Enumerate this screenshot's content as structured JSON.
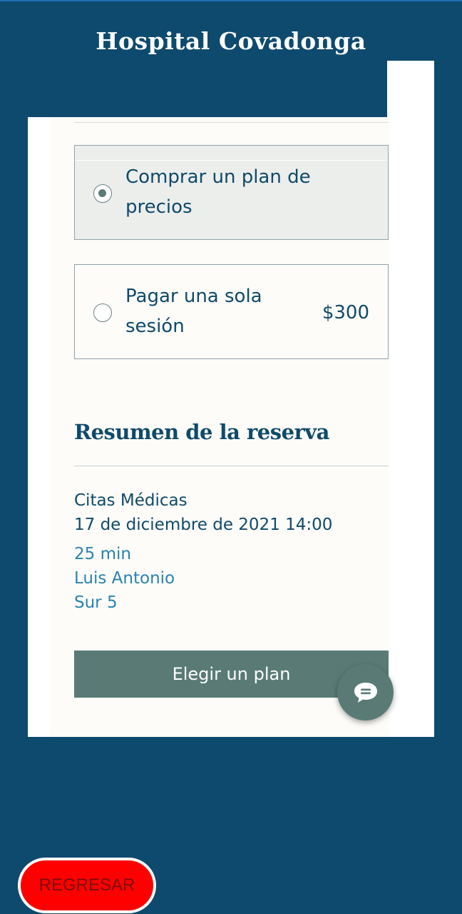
{
  "header": {
    "title": "Hospital Covadonga"
  },
  "options": [
    {
      "label": "Comprar un plan de precios",
      "price": "",
      "selected": true
    },
    {
      "label": "Pagar una sola sesión",
      "price": "$300",
      "selected": false
    }
  ],
  "summary": {
    "heading": "Resumen de la reserva",
    "service": "Citas Médicas",
    "datetime": "17 de diciembre de 2021 14:00",
    "duration": "25 min",
    "staff": "Luis Antonio",
    "location": "Sur 5"
  },
  "cta": {
    "label": "Elegir un plan"
  },
  "chat": {
    "icon": "chat-bubble-icon"
  },
  "back_button": {
    "label": "REGRESAR"
  },
  "colors": {
    "background": "#0d4a6e",
    "accent": "#5a7b75",
    "text_dark": "#0f4a6a",
    "text_link": "#2a82b0",
    "back_button": "#ff0000"
  }
}
